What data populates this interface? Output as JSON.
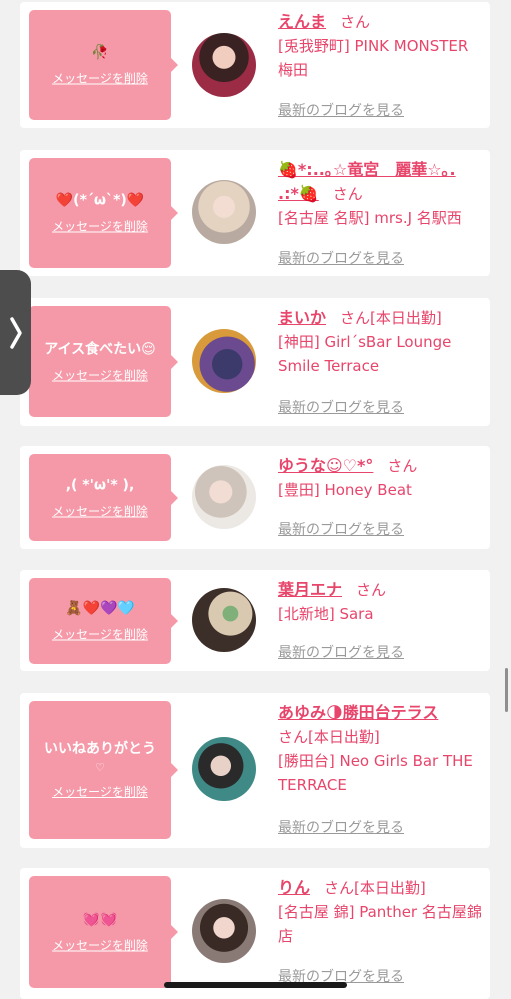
{
  "delete_label": "メッセージを削除",
  "blog_label": "最新のブログを見る",
  "san": "さん",
  "colors": {
    "bubble": "#f599a8",
    "name": "#e8456b",
    "link": "#9a9a9a",
    "side_tab": "#4d4d4d"
  },
  "items": [
    {
      "message": "🥀",
      "name": "えんま",
      "suffix": "",
      "shop": "[兎我野町] PINK MONSTER梅田"
    },
    {
      "message": "❤️(*´ω`*)❤️",
      "name": "🍓*:..｡☆竜宮　麗華☆｡. .:*🍓",
      "suffix": "",
      "shop": "[名古屋 名駅] mrs.J 名駅西"
    },
    {
      "message": "アイス食べたい😌",
      "name": "まいか",
      "suffix": "[本日出勤]",
      "shop": "[神田] Girl´sBar Lounge Smile Terrace"
    },
    {
      "message": ",( *'ω'* ),",
      "name": "ゆうな☺︎♡*°",
      "suffix": "",
      "shop": "[豊田] Honey Beat"
    },
    {
      "message": "🧸❤️💜🩵",
      "name": "葉月エナ",
      "suffix": "",
      "shop": "[北新地] Sara"
    },
    {
      "message": "いいねありがとう",
      "heart": "♡",
      "name": "あゆみ🌗勝田台テラス",
      "suffix": "[本日出勤]",
      "shop": "[勝田台] Neo Girls Bar THE TERRACE"
    },
    {
      "message": "💓💓",
      "name": "りん",
      "suffix": "[本日出勤]",
      "shop": "[名古屋 錦] Panther 名古屋錦店"
    }
  ]
}
